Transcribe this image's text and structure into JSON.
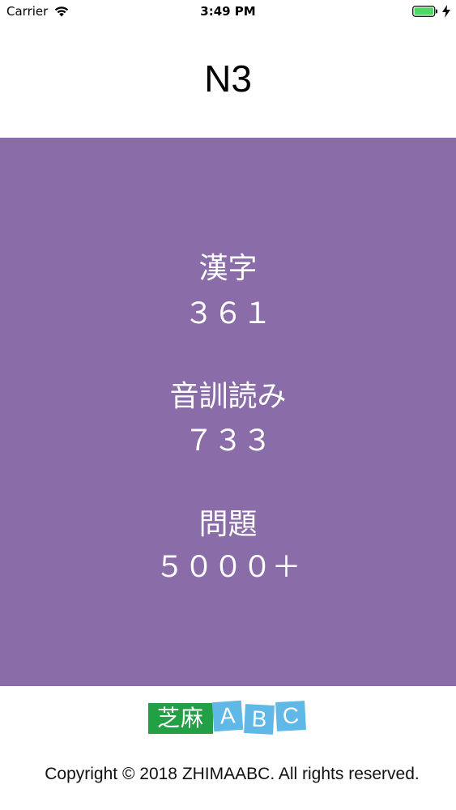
{
  "status_bar": {
    "carrier": "Carrier",
    "time": "3:49 PM",
    "wifi_icon": "wifi-icon",
    "battery_icon": "battery-icon",
    "charging_icon": "bolt-icon"
  },
  "header": {
    "title": "N3"
  },
  "stats": [
    {
      "label": "漢字",
      "value": "３６１"
    },
    {
      "label": "音訓読み",
      "value": "７３３"
    },
    {
      "label": "問題",
      "value": "５０００＋"
    }
  ],
  "footer": {
    "logo": {
      "chinese": "芝麻",
      "letters": [
        "A",
        "B",
        "C"
      ]
    },
    "copyright": "Copyright © 2018 ZHIMAABC. All rights reserved."
  },
  "colors": {
    "panel": "#8a6ca8",
    "logo_green": "#23a046",
    "logo_blue": "#5fb8e6",
    "battery_green": "#4cd964"
  }
}
